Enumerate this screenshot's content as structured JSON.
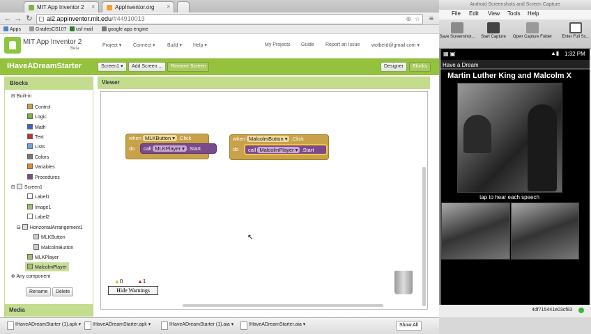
{
  "browser": {
    "tabs": [
      {
        "label": "MIT App Inventor 2"
      },
      {
        "label": "AppInventor.org"
      }
    ],
    "url_host": "ai2.appinventor.mit.edu",
    "url_path": "/#44910013",
    "bookmarks": [
      "Apps",
      "GradesCS107",
      "usf mail",
      "google app engine"
    ]
  },
  "app": {
    "name": "MIT App Inventor 2",
    "beta": "Beta",
    "menus": [
      "Project ▾",
      "Connect ▾",
      "Build ▾",
      "Help ▾"
    ],
    "right_menus": [
      "My Projects",
      "Guide",
      "Report an Issue",
      "wolberd@gmail.com ▾"
    ]
  },
  "project": {
    "name": "IHaveADreamStarter",
    "screen_select": "Screen1 ▾",
    "add_screen": "Add Screen ...",
    "remove_screen": "Remove Screen",
    "designer": "Designer",
    "blocks": "Blocks"
  },
  "blocks_panel": {
    "title": "Blocks",
    "builtin": "Built-in",
    "builtin_items": [
      {
        "label": "Control",
        "color": "#c8a24a"
      },
      {
        "label": "Logic",
        "color": "#7eb03c"
      },
      {
        "label": "Math",
        "color": "#3a66b8"
      },
      {
        "label": "Text",
        "color": "#b8342e"
      },
      {
        "label": "Lists",
        "color": "#6aa6d6"
      },
      {
        "label": "Colors",
        "color": "#7a7a7a"
      },
      {
        "label": "Variables",
        "color": "#e08a2c"
      },
      {
        "label": "Procedures",
        "color": "#7a4a8c"
      }
    ],
    "screen": "Screen1",
    "components": [
      "Label1",
      "Image1",
      "Label2"
    ],
    "arrangement": "HorizontalArrangement1",
    "arrangement_children": [
      "MLKButton",
      "MalcolmButton"
    ],
    "others": [
      "MLKPlayer",
      "MalcolmPlayer"
    ],
    "any_component": "Any component",
    "rename": "Rename",
    "delete": "Delete",
    "media": "Media"
  },
  "viewer": {
    "title": "Viewer",
    "block1": {
      "when": "when",
      "component": "MLKButton ▾",
      "event": ".Click",
      "do": "do",
      "call": "call",
      "target": "MLKPlayer ▾",
      "method": ".Start"
    },
    "block2": {
      "when": "when",
      "component": "MalcolmButton ▾",
      "event": ".Click",
      "do": "do",
      "call": "call",
      "target": "MalcolmPlayer ▾",
      "method": ".Start"
    },
    "warnings_count": "0",
    "errors_count": "1",
    "hide_warnings": "Hide Warnings"
  },
  "downloads": {
    "items": [
      "IHaveADreamStarter (1).apk ▾",
      "IHaveADreamStarter.apk ▾",
      "IHaveADreamStarter (1).aia ▾",
      "IHaveADreamStarter.aia ▾"
    ],
    "show_all": "Show All"
  },
  "mac_app": {
    "title": "Android Screenshots and Screen Capture",
    "menus": [
      "File",
      "Edit",
      "View",
      "Tools",
      "Help"
    ],
    "tools": [
      "Save Screenshot...",
      "Start Capture",
      "Open Capture Folder",
      "Enter Full Sc..."
    ],
    "device_id": "4df715441e03cf83"
  },
  "phone": {
    "time": "1:32 PM",
    "app_title": "Have a Dream",
    "label1": "Martin Luther King and Malcolm X",
    "label2": "tap to hear each speech"
  }
}
